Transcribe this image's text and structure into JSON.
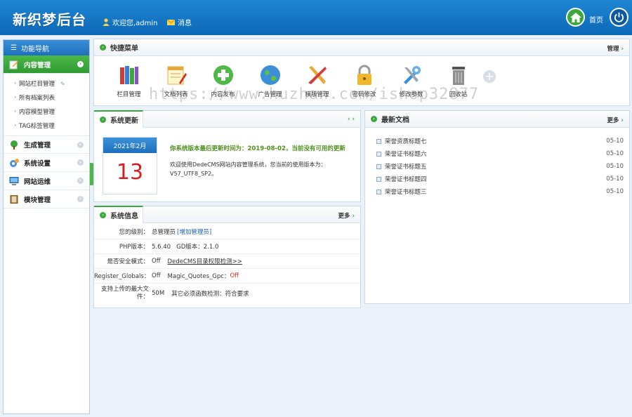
{
  "header": {
    "logo": "新织梦后台",
    "welcome": "欢迎您,admin",
    "messages": "消息",
    "home": "首页"
  },
  "sidebar": {
    "title": "功能导航",
    "groups": [
      {
        "label": "内容管理",
        "icon": "edit-icon",
        "active": true
      },
      {
        "label": "生成管理",
        "icon": "tree-icon",
        "active": false
      },
      {
        "label": "系统设置",
        "icon": "settings-icon",
        "active": false
      },
      {
        "label": "网站运维",
        "icon": "monitor-icon",
        "active": false
      },
      {
        "label": "模块管理",
        "icon": "book-icon",
        "active": false
      }
    ],
    "sub_items": [
      "网站栏目管理",
      "所有档案列表",
      "内容模型管理",
      "TAG标签管理"
    ]
  },
  "quick_menu": {
    "title": "快捷菜单",
    "manage": "管理",
    "items": [
      {
        "label": "栏目管理",
        "icon": "books-icon"
      },
      {
        "label": "文档列表",
        "icon": "notepad-icon"
      },
      {
        "label": "内容发布",
        "icon": "add-circle-icon"
      },
      {
        "label": "广告管理",
        "icon": "globe-icon"
      },
      {
        "label": "模版管理",
        "icon": "tools-icon"
      },
      {
        "label": "密码修改",
        "icon": "lock-icon"
      },
      {
        "label": "修改参数",
        "icon": "wrench-icon"
      },
      {
        "label": "回收站",
        "icon": "trash-icon"
      }
    ]
  },
  "update": {
    "title": "系统更新",
    "calendar_month": "2021年2月",
    "calendar_day": "13",
    "headline": "你系统版本最后更新时间为：2019-08-02，当前没有可用的更新",
    "body": "欢迎使用DedeCMS网站内容管理系统，您当前的使用版本为：V57_UTF8_SP2。"
  },
  "system_info": {
    "title": "系统信息",
    "more": "更多",
    "rows": [
      {
        "key": "您的级别：",
        "value": "总管理员",
        "link": "[增加管理员]"
      },
      {
        "key": "PHP版本：",
        "value": "5.6.40   GD版本：2.1.0"
      },
      {
        "key": "是否安全模式：",
        "value_red": "Off",
        "link": "DedeCMS目录权限检测>>"
      },
      {
        "key": "Register_Globals：",
        "value_red": "Off",
        "value2": "Magic_Quotes_Gpc：",
        "value2_red": "Off"
      },
      {
        "key": "支持上传的最大文件：",
        "value_red": "50M",
        "value2": "其它必须函数检测：符合要求"
      }
    ]
  },
  "latest_docs": {
    "title": "最新文档",
    "more": "更多",
    "items": [
      {
        "title": "荣誉资质标题七",
        "date": "05-10"
      },
      {
        "title": "荣誉证书标题六",
        "date": "05-10"
      },
      {
        "title": "荣誉证书标题五",
        "date": "05-10"
      },
      {
        "title": "荣誉证书标题四",
        "date": "05-10"
      },
      {
        "title": "荣誉证书标题三",
        "date": "05-10"
      }
    ]
  },
  "watermark": "https://www.huzhan.com/ishop32877",
  "colors": {
    "header_blue": "#1a7ccb",
    "accent_green": "#3aa83a",
    "alert_red": "#e0261b"
  }
}
